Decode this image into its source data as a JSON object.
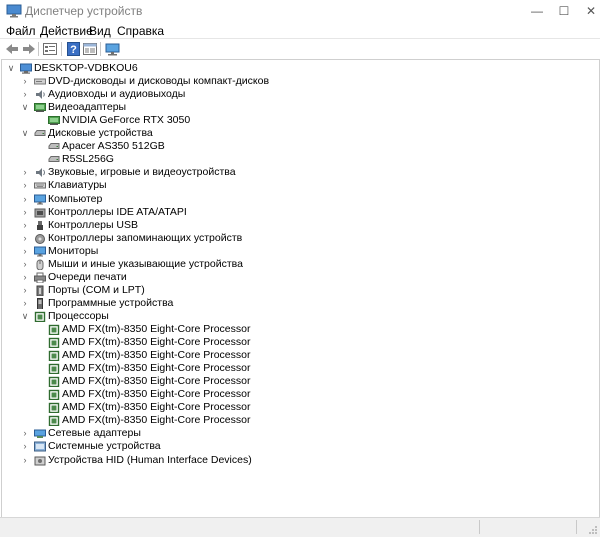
{
  "window": {
    "title": "Диспетчер устройств",
    "controls": {
      "minimize": "—",
      "maximize": "☐",
      "close": "✕"
    }
  },
  "menu": [
    "Файл",
    "Действие",
    "Вид",
    "Справка"
  ],
  "toolbar": {
    "buttons": [
      "back-icon",
      "forward-icon",
      "properties-icon",
      "help-icon",
      "show-hide-icon",
      "monitor-icon"
    ]
  },
  "tree": [
    {
      "depth": 0,
      "expander": "expanded",
      "icon": "computer-icon",
      "label": "DESKTOP-VDBKOU6"
    },
    {
      "depth": 1,
      "expander": "collapsed",
      "icon": "dvd-icon",
      "label": "DVD-дисководы и дисководы компакт-дисков"
    },
    {
      "depth": 1,
      "expander": "collapsed",
      "icon": "audio-icon",
      "label": "Аудиовходы и аудиовыходы"
    },
    {
      "depth": 1,
      "expander": "expanded",
      "icon": "display-adapter-icon",
      "label": "Видеоадаптеры"
    },
    {
      "depth": 2,
      "expander": "none",
      "icon": "display-adapter-icon",
      "label": "NVIDIA GeForce RTX 3050"
    },
    {
      "depth": 1,
      "expander": "expanded",
      "icon": "disk-icon",
      "label": "Дисковые устройства"
    },
    {
      "depth": 2,
      "expander": "none",
      "icon": "disk-icon",
      "label": "Apacer AS350 512GB"
    },
    {
      "depth": 2,
      "expander": "none",
      "icon": "disk-icon",
      "label": "R5SL256G"
    },
    {
      "depth": 1,
      "expander": "collapsed",
      "icon": "sound-icon",
      "label": "Звуковые, игровые и видеоустройства"
    },
    {
      "depth": 1,
      "expander": "collapsed",
      "icon": "keyboard-icon",
      "label": "Клавиатуры"
    },
    {
      "depth": 1,
      "expander": "collapsed",
      "icon": "monitor-icon",
      "label": "Компьютер"
    },
    {
      "depth": 1,
      "expander": "collapsed",
      "icon": "ide-icon",
      "label": "Контроллеры IDE ATA/ATAPI"
    },
    {
      "depth": 1,
      "expander": "collapsed",
      "icon": "usb-icon",
      "label": "Контроллеры USB"
    },
    {
      "depth": 1,
      "expander": "collapsed",
      "icon": "storage-icon",
      "label": "Контроллеры запоминающих устройств"
    },
    {
      "depth": 1,
      "expander": "collapsed",
      "icon": "monitor-icon",
      "label": "Мониторы"
    },
    {
      "depth": 1,
      "expander": "collapsed",
      "icon": "mouse-icon",
      "label": "Мыши и иные указывающие устройства"
    },
    {
      "depth": 1,
      "expander": "collapsed",
      "icon": "printer-icon",
      "label": "Очереди печати"
    },
    {
      "depth": 1,
      "expander": "collapsed",
      "icon": "port-icon",
      "label": "Порты (COM и LPT)"
    },
    {
      "depth": 1,
      "expander": "collapsed",
      "icon": "software-device-icon",
      "label": "Программные устройства"
    },
    {
      "depth": 1,
      "expander": "expanded",
      "icon": "processor-icon",
      "label": "Процессоры"
    },
    {
      "depth": 2,
      "expander": "none",
      "icon": "processor-icon",
      "label": "AMD FX(tm)-8350 Eight-Core Processor"
    },
    {
      "depth": 2,
      "expander": "none",
      "icon": "processor-icon",
      "label": "AMD FX(tm)-8350 Eight-Core Processor"
    },
    {
      "depth": 2,
      "expander": "none",
      "icon": "processor-icon",
      "label": "AMD FX(tm)-8350 Eight-Core Processor"
    },
    {
      "depth": 2,
      "expander": "none",
      "icon": "processor-icon",
      "label": "AMD FX(tm)-8350 Eight-Core Processor"
    },
    {
      "depth": 2,
      "expander": "none",
      "icon": "processor-icon",
      "label": "AMD FX(tm)-8350 Eight-Core Processor"
    },
    {
      "depth": 2,
      "expander": "none",
      "icon": "processor-icon",
      "label": "AMD FX(tm)-8350 Eight-Core Processor"
    },
    {
      "depth": 2,
      "expander": "none",
      "icon": "processor-icon",
      "label": "AMD FX(tm)-8350 Eight-Core Processor"
    },
    {
      "depth": 2,
      "expander": "none",
      "icon": "processor-icon",
      "label": "AMD FX(tm)-8350 Eight-Core Processor"
    },
    {
      "depth": 1,
      "expander": "collapsed",
      "icon": "network-icon",
      "label": "Сетевые адаптеры"
    },
    {
      "depth": 1,
      "expander": "collapsed",
      "icon": "system-device-icon",
      "label": "Системные устройства"
    },
    {
      "depth": 1,
      "expander": "collapsed",
      "icon": "hid-icon",
      "label": "Устройства HID (Human Interface Devices)"
    }
  ]
}
